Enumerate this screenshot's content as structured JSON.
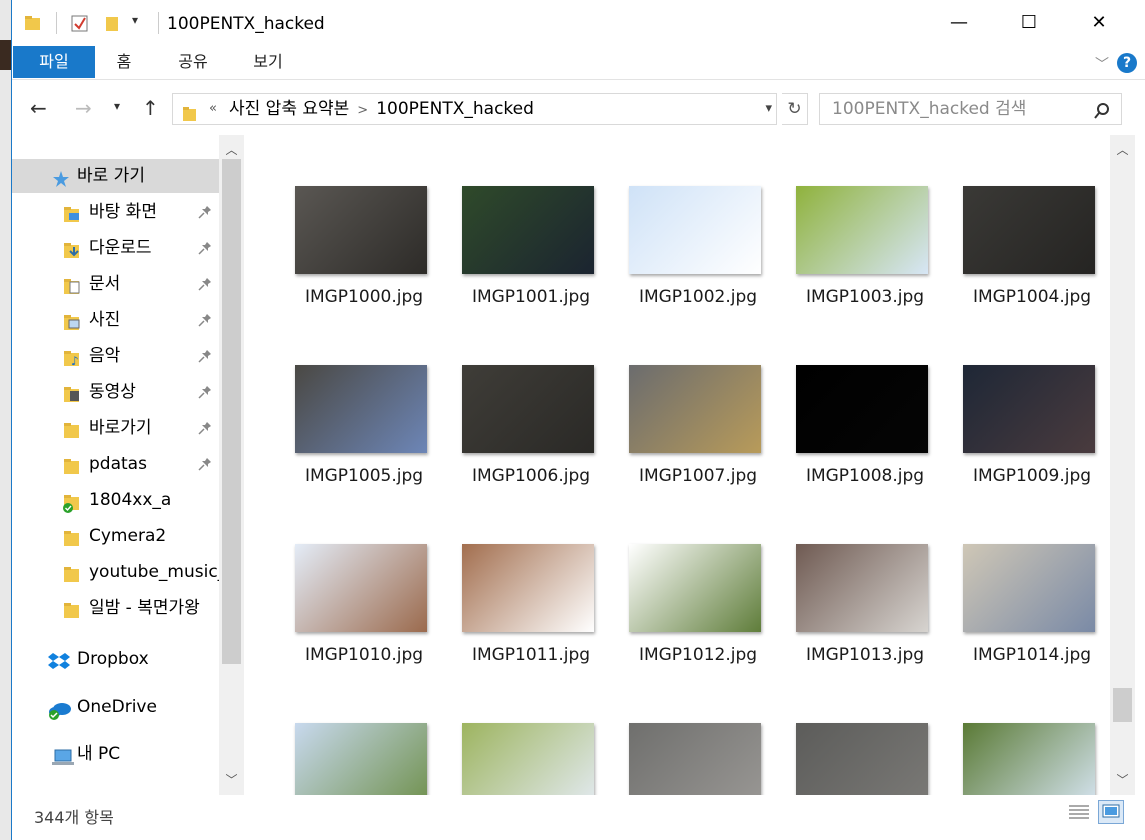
{
  "window": {
    "title": "100PENTX_hacked",
    "minimize": "—",
    "maximize": "☐",
    "close": "✕"
  },
  "ribbon": {
    "tabs": [
      "파일",
      "홈",
      "공유",
      "보기"
    ],
    "help": "?"
  },
  "address": {
    "prefix": "«",
    "crumbs": [
      "사진 압축 요약본",
      "100PENTX_hacked"
    ]
  },
  "search": {
    "placeholder": "100PENTX_hacked 검색"
  },
  "nav": {
    "quick_access": "바로 가기",
    "items": [
      {
        "label": "바탕 화면",
        "pinned": true,
        "icon": "desktop-folder-icon"
      },
      {
        "label": "다운로드",
        "pinned": true,
        "icon": "downloads-folder-icon"
      },
      {
        "label": "문서",
        "pinned": true,
        "icon": "documents-folder-icon"
      },
      {
        "label": "사진",
        "pinned": true,
        "icon": "pictures-folder-icon"
      },
      {
        "label": "음악",
        "pinned": true,
        "icon": "music-folder-icon"
      },
      {
        "label": "동영상",
        "pinned": true,
        "icon": "videos-folder-icon"
      },
      {
        "label": "바로가기",
        "pinned": true,
        "icon": "folder-icon"
      },
      {
        "label": "pdatas",
        "pinned": true,
        "icon": "folder-icon"
      },
      {
        "label": "1804xx_a",
        "pinned": false,
        "icon": "synced-folder-icon"
      },
      {
        "label": "Cymera2",
        "pinned": false,
        "icon": "folder-icon"
      },
      {
        "label": "youtube_music_",
        "pinned": false,
        "icon": "folder-icon"
      },
      {
        "label": "일밤 - 복면가왕",
        "pinned": false,
        "icon": "folder-icon"
      }
    ],
    "dropbox": "Dropbox",
    "onedrive": "OneDrive",
    "this_pc": "내 PC"
  },
  "files": [
    {
      "name": "IMGP1000.jpg",
      "c1": "#5a5753",
      "c2": "#2d2b28"
    },
    {
      "name": "IMGP1001.jpg",
      "c1": "#2f4a2a",
      "c2": "#1b2430"
    },
    {
      "name": "IMGP1002.jpg",
      "c1": "#cfe2f7",
      "c2": "#ffffff"
    },
    {
      "name": "IMGP1003.jpg",
      "c1": "#8fb23c",
      "c2": "#d7e6f6"
    },
    {
      "name": "IMGP1004.jpg",
      "c1": "#3a3936",
      "c2": "#252422"
    },
    {
      "name": "IMGP1005.jpg",
      "c1": "#4a4843",
      "c2": "#6d86b7"
    },
    {
      "name": "IMGP1006.jpg",
      "c1": "#3f3d38",
      "c2": "#2a2926"
    },
    {
      "name": "IMGP1007.jpg",
      "c1": "#6b6c6e",
      "c2": "#b89b5a"
    },
    {
      "name": "IMGP1008.jpg",
      "c1": "#000000",
      "c2": "#050505"
    },
    {
      "name": "IMGP1009.jpg",
      "c1": "#1e2736",
      "c2": "#4a3b3e"
    },
    {
      "name": "IMGP1010.jpg",
      "c1": "#e4ecf7",
      "c2": "#9b6a4d"
    },
    {
      "name": "IMGP1011.jpg",
      "c1": "#a26e4e",
      "c2": "#ffffff"
    },
    {
      "name": "IMGP1012.jpg",
      "c1": "#ffffff",
      "c2": "#5f7d3a"
    },
    {
      "name": "IMGP1013.jpg",
      "c1": "#6f5a52",
      "c2": "#d7d4d0"
    },
    {
      "name": "IMGP1014.jpg",
      "c1": "#cfc7b6",
      "c2": "#7a8aa6"
    },
    {
      "name": "",
      "c1": "#c8d9ee",
      "c2": "#6e8f4a"
    },
    {
      "name": "",
      "c1": "#9db45f",
      "c2": "#e4ebf3"
    },
    {
      "name": "",
      "c1": "#6f6f6d",
      "c2": "#9a9895"
    },
    {
      "name": "",
      "c1": "#5c5c5a",
      "c2": "#7b7a77"
    },
    {
      "name": "",
      "c1": "#5a7a35",
      "c2": "#d8e6f4"
    }
  ],
  "status": {
    "count": "344개 항목"
  },
  "colors": {
    "accent": "#1979ca",
    "selection": "#d9d9d9"
  }
}
